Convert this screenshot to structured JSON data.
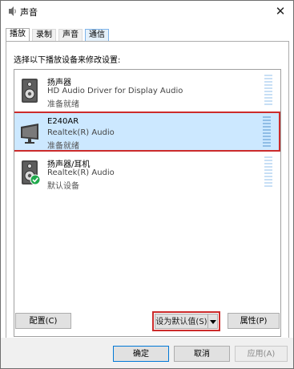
{
  "window": {
    "title": "声音",
    "close_glyph": "✕"
  },
  "tabs": [
    {
      "label": "播放",
      "active": true
    },
    {
      "label": "录制"
    },
    {
      "label": "声音"
    },
    {
      "label": "通信"
    }
  ],
  "panel": {
    "instruction": "选择以下播放设备来修改设置:"
  },
  "devices": [
    {
      "name": "扬声器",
      "driver": "HD Audio Driver for Display Audio",
      "status": "准备就绪",
      "icon": "speaker-icon",
      "selected": false
    },
    {
      "name": "E240AR",
      "driver": "Realtek(R) Audio",
      "status": "准备就绪",
      "icon": "monitor-icon",
      "selected": true
    },
    {
      "name": "扬声器/耳机",
      "driver": "Realtek(R) Audio",
      "status": "默认设备",
      "icon": "speaker-default-icon",
      "default": true
    }
  ],
  "buttons": {
    "configure": "配置(C)",
    "set_default": "设为默认值(S)",
    "properties": "属性(P)",
    "ok": "确定",
    "cancel": "取消",
    "apply": "应用(A)"
  },
  "footer_peek": "",
  "colors": {
    "selection": "#cce8ff",
    "highlight_border": "#cc2b2b",
    "default_check": "#1fa94b"
  }
}
